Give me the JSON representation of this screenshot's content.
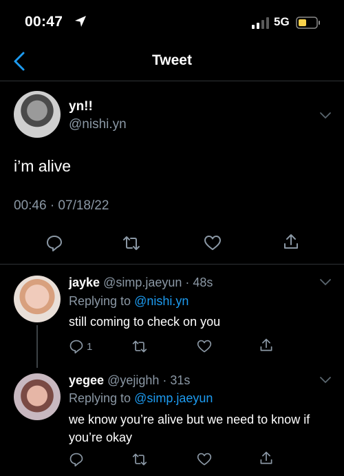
{
  "status_bar": {
    "time": "00:47",
    "network": "5G",
    "battery_color": "#f9d24b"
  },
  "nav": {
    "title": "Tweet"
  },
  "main_tweet": {
    "display_name": "yn!!",
    "handle": "@nishi.yn",
    "text": "i’m alive",
    "meta": "00:46 · 07/18/22"
  },
  "replies": [
    {
      "display_name": "jayke",
      "handle_time": "@simp.jaeyun · 48s",
      "replying_prefix": "Replying to ",
      "replying_to": "@nishi.yn",
      "text": "still coming to check on you",
      "reply_count": "1"
    },
    {
      "display_name": "yegee",
      "handle_time": "@yejighh · 31s",
      "replying_prefix": "Replying to ",
      "replying_to": "@simp.jaeyun",
      "text": "we know you’re alive but we need to know if you’re okay",
      "reply_count": ""
    }
  ],
  "colors": {
    "background": "#000000",
    "accent": "#1d9bf0",
    "muted": "#8b98a5",
    "divider": "#2f3336"
  },
  "icons": {
    "reply": "speech-bubble-icon",
    "retweet": "retweet-arrows-icon",
    "like": "heart-icon",
    "share": "share-arrow-icon"
  }
}
